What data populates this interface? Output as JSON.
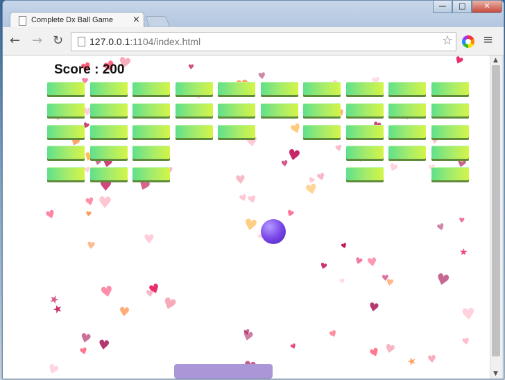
{
  "browser": {
    "tab_title": "Complete Dx Ball Game",
    "tab_close": "×",
    "url_host": "127.0.0.1",
    "url_rest": ":1104/index.html",
    "back": "←",
    "forward": "→",
    "reload": "↻",
    "star": "☆",
    "menu": "≡",
    "minimize": "—",
    "maximize": "□",
    "close": "✕",
    "scroll_up": "▲",
    "scroll_down": "▼"
  },
  "game": {
    "score_text": "Score : 200",
    "brick_rows": [
      [
        1,
        1,
        1,
        1,
        1,
        1,
        1,
        1,
        1,
        1
      ],
      [
        1,
        1,
        1,
        1,
        1,
        1,
        1,
        1,
        1,
        1
      ],
      [
        1,
        1,
        1,
        1,
        1,
        0,
        1,
        1,
        1,
        1
      ],
      [
        1,
        1,
        1,
        0,
        0,
        0,
        0,
        1,
        1,
        1
      ],
      [
        1,
        1,
        1,
        0,
        0,
        0,
        0,
        1,
        0,
        1
      ]
    ],
    "colors": {
      "brick_from": "#5fe08c",
      "brick_to": "#d4f547",
      "ball": "#7a48e8",
      "paddle": "#a997d8",
      "heart_palette": [
        "#ff6f91",
        "#ffb3c6",
        "#ffc0d0",
        "#e91e63",
        "#b0306a",
        "#ff8c42",
        "#ffbb55",
        "#c2185b",
        "#ff4d6d",
        "#f7a8b8"
      ]
    },
    "icons": [
      "heart-icon",
      "star-icon",
      "ball-icon",
      "paddle-icon"
    ]
  }
}
